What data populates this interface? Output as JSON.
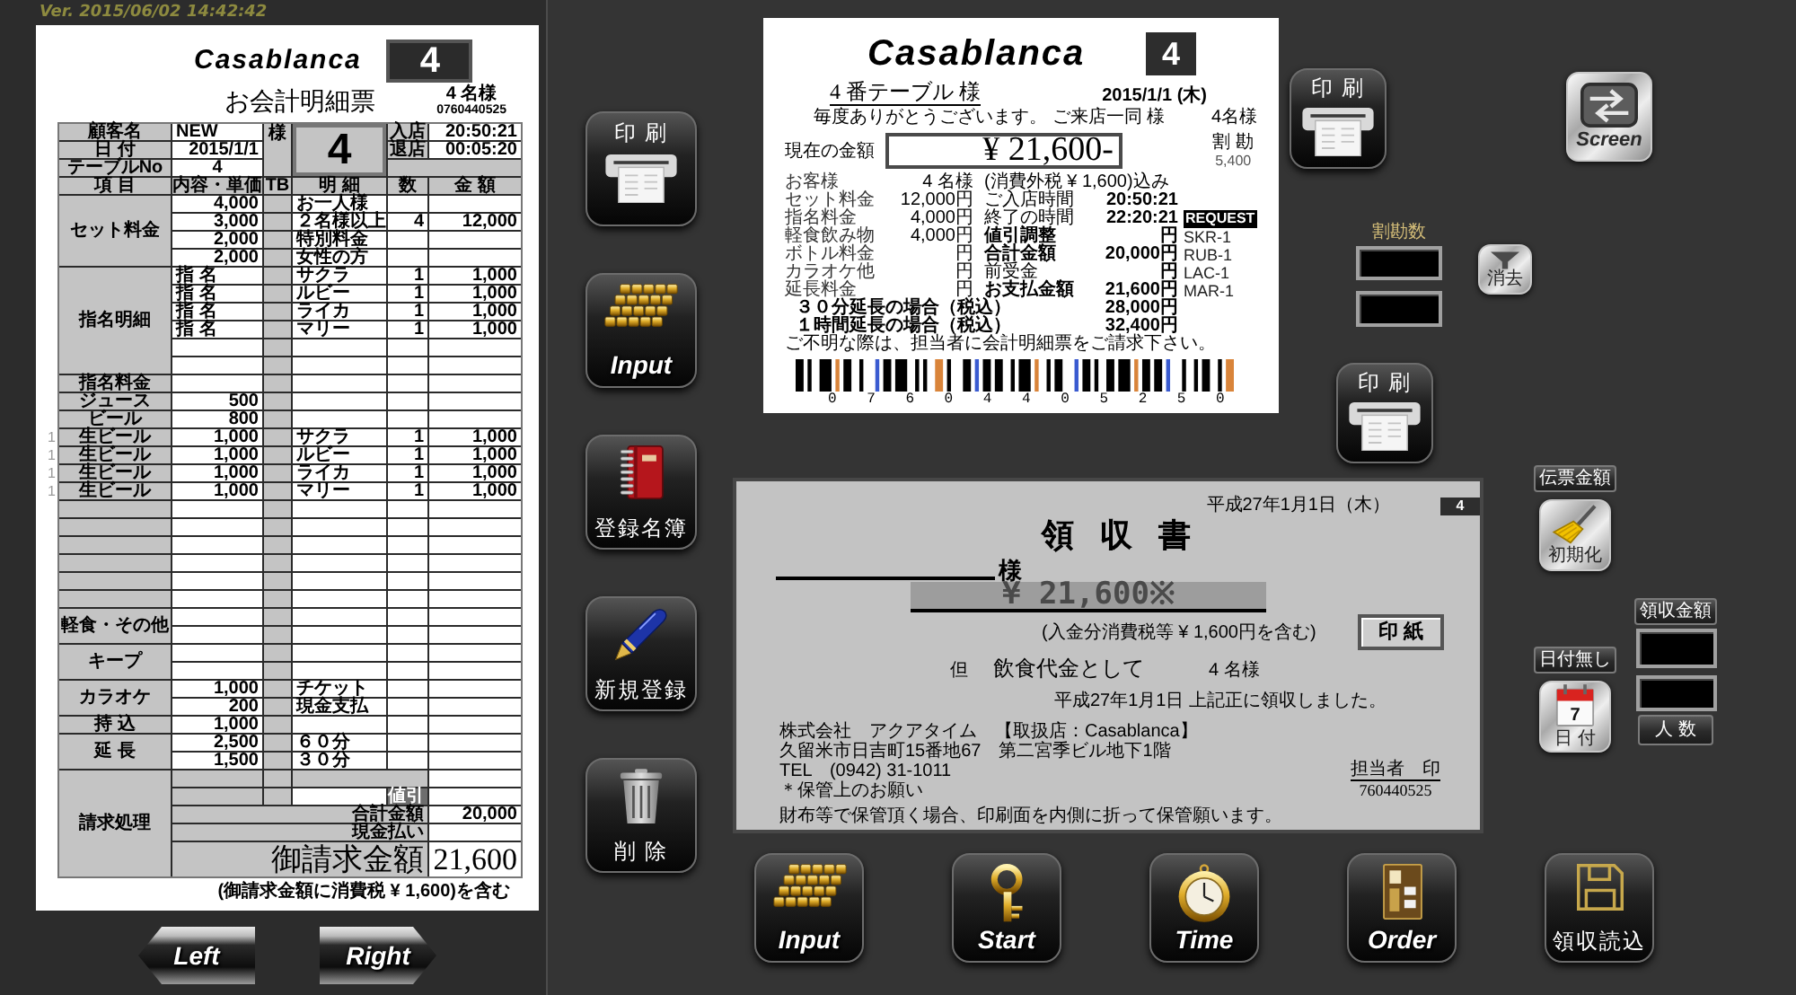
{
  "version": "Ver. 2015/06/02 14:42:42",
  "invoice": {
    "logo": "Casablanca",
    "table_badge": "4",
    "title": "お会計明細票",
    "guests": "4 名様",
    "code": "0760440525",
    "header": {
      "customer_label": "顧客名",
      "customer": "NEW",
      "honorific": "様",
      "date_label": "日 付",
      "date": "2015/1/1",
      "table_label": "テーブルNo",
      "table_no": "4",
      "table_big": "4",
      "in_label": "入店",
      "in_time": "20:50:21",
      "out_label": "退店",
      "out_time": "00:05:20"
    },
    "columns": [
      "項 目",
      "内容・単価",
      "TB",
      "明 細",
      "数",
      "金 額"
    ],
    "sections": [
      {
        "label": "セット料金",
        "rows": [
          {
            "kind": "item",
            "price": "4,000",
            "detail": "お一人様"
          },
          {
            "kind": "item",
            "price": "3,000",
            "detail": "２名様以上",
            "qty": "4",
            "amount": "12,000"
          },
          {
            "kind": "item",
            "price": "2,000",
            "detail": "特別料金"
          },
          {
            "kind": "item",
            "price": "2,000",
            "detail": "女性の方"
          }
        ]
      },
      {
        "label": "指名明細",
        "rows": [
          {
            "kind": "item",
            "content": "指 名",
            "detail": "サクラ",
            "qty": "1",
            "amount": "1,000"
          },
          {
            "kind": "item",
            "content": "指 名",
            "detail": "ルビー",
            "qty": "1",
            "amount": "1,000"
          },
          {
            "kind": "item",
            "content": "指 名",
            "detail": "ライカ",
            "qty": "1",
            "amount": "1,000"
          },
          {
            "kind": "item",
            "content": "指 名",
            "detail": "マリー",
            "qty": "1",
            "amount": "1,000"
          },
          {
            "kind": "blank"
          },
          {
            "kind": "blank"
          }
        ]
      },
      {
        "label": "指名料金",
        "rows": [
          {
            "kind": "blank"
          }
        ]
      },
      {
        "label": "ジュース",
        "rows": [
          {
            "kind": "item",
            "price": "500"
          }
        ]
      },
      {
        "label": "ビール",
        "rows": [
          {
            "kind": "item",
            "price": "800"
          }
        ]
      },
      {
        "label": "生ビール",
        "mark": "1",
        "rows": [
          {
            "kind": "item",
            "price": "1,000",
            "detail": "サクラ",
            "qty": "1",
            "amount": "1,000"
          }
        ]
      },
      {
        "label": "生ビール",
        "mark": "1",
        "rows": [
          {
            "kind": "item",
            "price": "1,000",
            "detail": "ルビー",
            "qty": "1",
            "amount": "1,000"
          }
        ]
      },
      {
        "label": "生ビール",
        "mark": "1",
        "rows": [
          {
            "kind": "item",
            "price": "1,000",
            "detail": "ライカ",
            "qty": "1",
            "amount": "1,000"
          }
        ]
      },
      {
        "label": "生ビール",
        "mark": "1",
        "rows": [
          {
            "kind": "item",
            "price": "1,000",
            "detail": "マリー",
            "qty": "1",
            "amount": "1,000"
          }
        ]
      },
      {
        "rows": [
          {
            "kind": "blank"
          }
        ]
      },
      {
        "rows": [
          {
            "kind": "blank"
          }
        ]
      },
      {
        "rows": [
          {
            "kind": "blank"
          }
        ]
      },
      {
        "rows": [
          {
            "kind": "blank"
          }
        ]
      },
      {
        "rows": [
          {
            "kind": "blank"
          }
        ]
      },
      {
        "rows": [
          {
            "kind": "blank"
          }
        ]
      },
      {
        "label": "軽食・その他",
        "rows": [
          {
            "kind": "blank"
          },
          {
            "kind": "blank"
          }
        ]
      },
      {
        "label": "キープ",
        "rows": [
          {
            "kind": "blank"
          },
          {
            "kind": "blank"
          }
        ]
      },
      {
        "label": "カラオケ",
        "rows": [
          {
            "kind": "item",
            "price": "1,000",
            "detail": "チケット"
          },
          {
            "kind": "item",
            "price": "200",
            "detail": "現金支払"
          }
        ]
      },
      {
        "label": "持 込",
        "rows": [
          {
            "kind": "item",
            "price": "1,000"
          }
        ]
      },
      {
        "label": "延 長",
        "rows": [
          {
            "kind": "item",
            "price": "2,500",
            "detail": "６０分"
          },
          {
            "kind": "item",
            "price": "1,500",
            "detail": "３０分"
          }
        ]
      }
    ],
    "billing": {
      "label": "請求処理",
      "discount_label": "値引",
      "subtotal_label": "合計金額",
      "subtotal": "20,000",
      "cash_label": "現金払い",
      "total_label": "御請求金額",
      "total": "21,600"
    },
    "tax_note": "(御請求金額に消費税 ¥ 1,600)を含む"
  },
  "nav": [
    {
      "kind": "left",
      "label": "Left"
    },
    {
      "kind": "right",
      "label": "Right"
    }
  ],
  "side_buttons": [
    {
      "kind": "print",
      "label": "印 刷"
    },
    {
      "kind": "keyboard",
      "label": "Input"
    },
    {
      "kind": "book",
      "label": "登録名簿"
    },
    {
      "kind": "pen",
      "label": "新規登録"
    },
    {
      "kind": "trash",
      "label": "削 除"
    }
  ],
  "receipt": {
    "logo": "Casablanca",
    "table_badge": "4",
    "customer": "4 番テーブル 様",
    "date": "2015/1/1 (木)",
    "greeting": "毎度ありがとうございます。 ご来店一同 様",
    "guests": "4名様",
    "current_label": "現在の金額",
    "current_amount": "¥ 21,600-",
    "split_label": "割 勘",
    "split_amount": "5,400",
    "rows": [
      {
        "label": "お客様",
        "value": "4 名様",
        "note": "(消費外税 ¥ 1,600)込み",
        "strong": false
      },
      {
        "label": "セット料金",
        "value": "12,000円",
        "label2": "ご入店時間",
        "value2": "20:50:21",
        "strong": false
      },
      {
        "label": "指名料金",
        "value": "4,000円",
        "label2": "終了の時間",
        "value2": "22:20:21",
        "strong": false,
        "tag": {
          "text": "REQUEST",
          "inverted": true
        }
      },
      {
        "label": "軽食飲み物",
        "value": "4,000円",
        "label2": "値引調整",
        "value2": "円",
        "strong": true,
        "tag": {
          "text": "SKR-1",
          "inverted": false
        }
      },
      {
        "label": "ボトル料金",
        "value": "円",
        "label2": "合計金額",
        "value2": "20,000円",
        "strong": true,
        "tag": {
          "text": "RUB-1",
          "inverted": false
        }
      },
      {
        "label": "カラオケ他",
        "value": "円",
        "label2": "前受金",
        "value2": "円",
        "strong": false,
        "tag": {
          "text": "LAC-1",
          "inverted": false
        }
      },
      {
        "label": "延長料金",
        "value": "円",
        "label2": "お支払金額",
        "value2": "21,600円",
        "strong": true,
        "tag": {
          "text": "MAR-1",
          "inverted": false
        }
      }
    ],
    "extensions": [
      {
        "label": "３０分延長の場合（税込）",
        "amount": "28,000円"
      },
      {
        "label": "１時間延長の場合（税込）",
        "amount": "32,400円"
      }
    ],
    "notice": "ご不明な際は、担当者に会計明細票をご請求下さい。",
    "barcode_digits": "0 7 6 0 4 4 0 5 2 5 0"
  },
  "print_top": {
    "label": "印 刷"
  },
  "split": {
    "label": "割勘数",
    "clear_label": "消去"
  },
  "print_slip": {
    "label": "印 刷"
  },
  "screen_button": {
    "label": "Screen"
  },
  "slip": {
    "date": "平成27年1月1日（木）",
    "badge": "4",
    "title": "領 収 書",
    "honorific": "様",
    "amount": "¥ 21,600※",
    "tax_note": "(入金分消費税等 ¥ 1,600円を含む)",
    "stamp": "印 紙",
    "proviso_label": "但",
    "proviso": "飲食代金として",
    "guests": "4 名様",
    "received": "平成27年1月1日 上記正に領収しました。",
    "company": [
      "株式会社　アクアタイム　【取扱店：Casablanca】",
      "久留米市日吉町15番地67　第二宮季ビル地下1階",
      "TEL　(0942) 31-1011",
      "＊保管上のお願い"
    ],
    "notice": "財布等で保管頂く場合、印刷面を内側に折って保管願います。",
    "staff": "担当者　印",
    "staff_code": "760440525"
  },
  "slip_amount": {
    "label": "伝票金額",
    "reset_label": "初期化"
  },
  "date_controls": {
    "label": "日付無し",
    "button_label": "日 付",
    "calendar_day": "7"
  },
  "received_amount": {
    "label": "領収金額",
    "people_label": "人 数"
  },
  "bottom_buttons": [
    {
      "kind": "keyboard",
      "label": "Input"
    },
    {
      "kind": "key",
      "label": "Start"
    },
    {
      "kind": "watch",
      "label": "Time"
    },
    {
      "kind": "order",
      "label": "Order"
    },
    {
      "kind": "disk",
      "label": "領収読込"
    }
  ]
}
